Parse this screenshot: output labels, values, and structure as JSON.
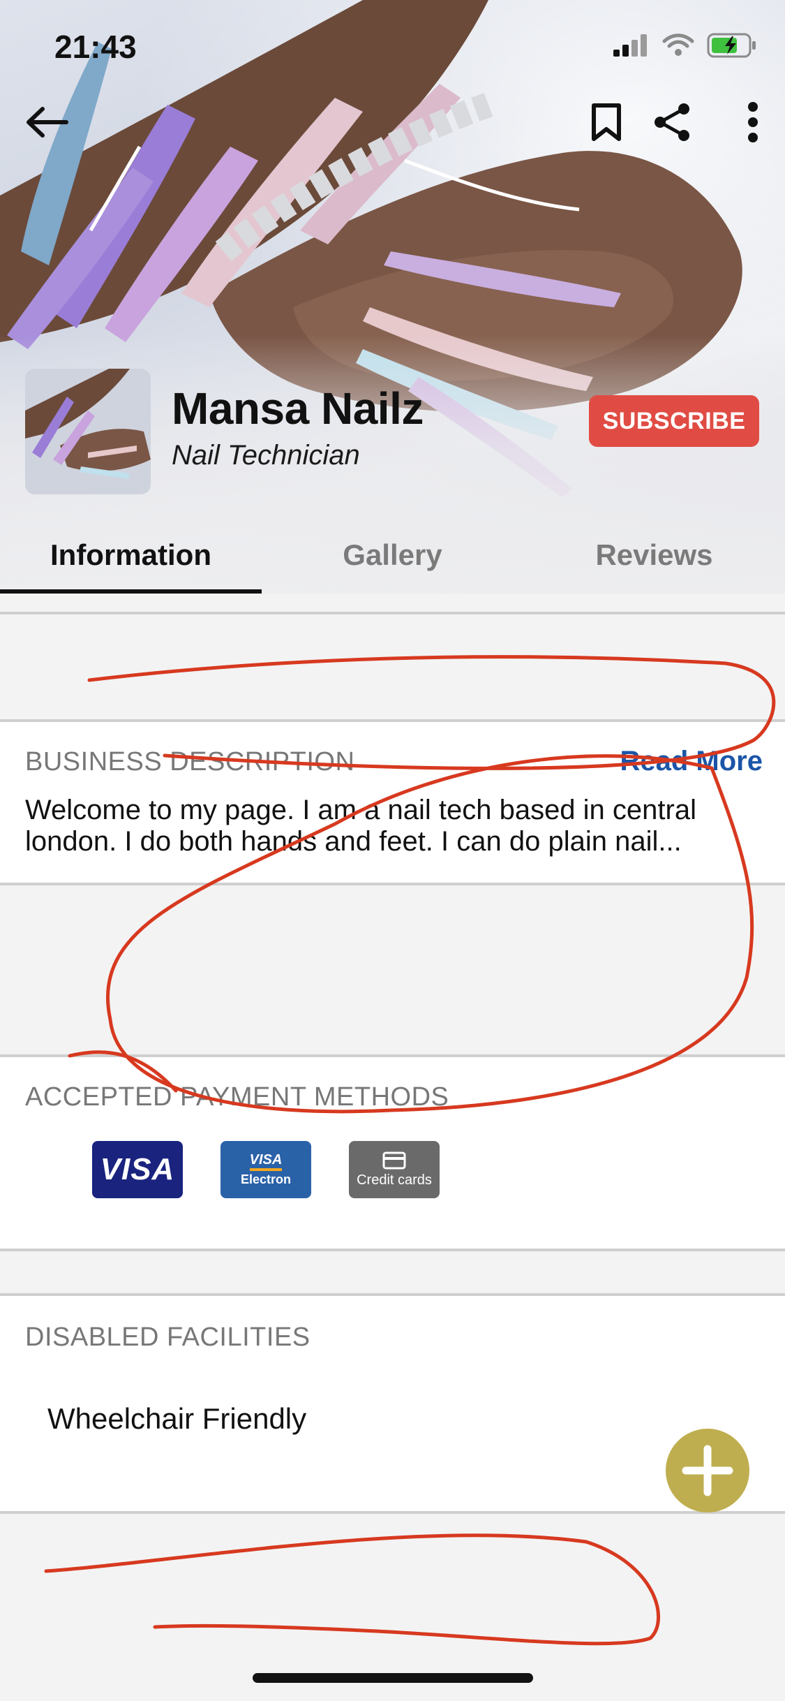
{
  "status_bar": {
    "time": "21:43"
  },
  "header": {
    "business_name": "Mansa Nailz",
    "business_role": "Nail Technician",
    "subscribe_label": "SUBSCRIBE"
  },
  "tabs": [
    {
      "label": "Information",
      "active": true
    },
    {
      "label": "Gallery",
      "active": false
    },
    {
      "label": "Reviews",
      "active": false
    }
  ],
  "business_description": {
    "title": "BUSINESS DESCRIPTION",
    "read_more_label": "Read More",
    "text": "Welcome to my page. I am a nail tech based in central london. I do both hands and feet. I can do plain nail..."
  },
  "payment_methods": {
    "title": "ACCEPTED PAYMENT METHODS",
    "visa_label": "VISA",
    "visa_electron_top": "VISA",
    "visa_electron_bottom": "Electron",
    "credit_cards_label": "Credit cards"
  },
  "disabled_facilities": {
    "title": "DISABLED FACILITIES",
    "items": [
      "Wheelchair Friendly"
    ]
  },
  "colors": {
    "subscribe": "#e04c44",
    "read_more": "#1b55a8",
    "fab": "#bfae4f",
    "annotation": "#d7391f"
  },
  "icons": [
    "back-arrow-icon",
    "bookmark-icon",
    "share-icon",
    "more-vertical-icon",
    "plus-icon",
    "credit-card-icon",
    "signal-icon",
    "wifi-icon",
    "battery-icon"
  ]
}
